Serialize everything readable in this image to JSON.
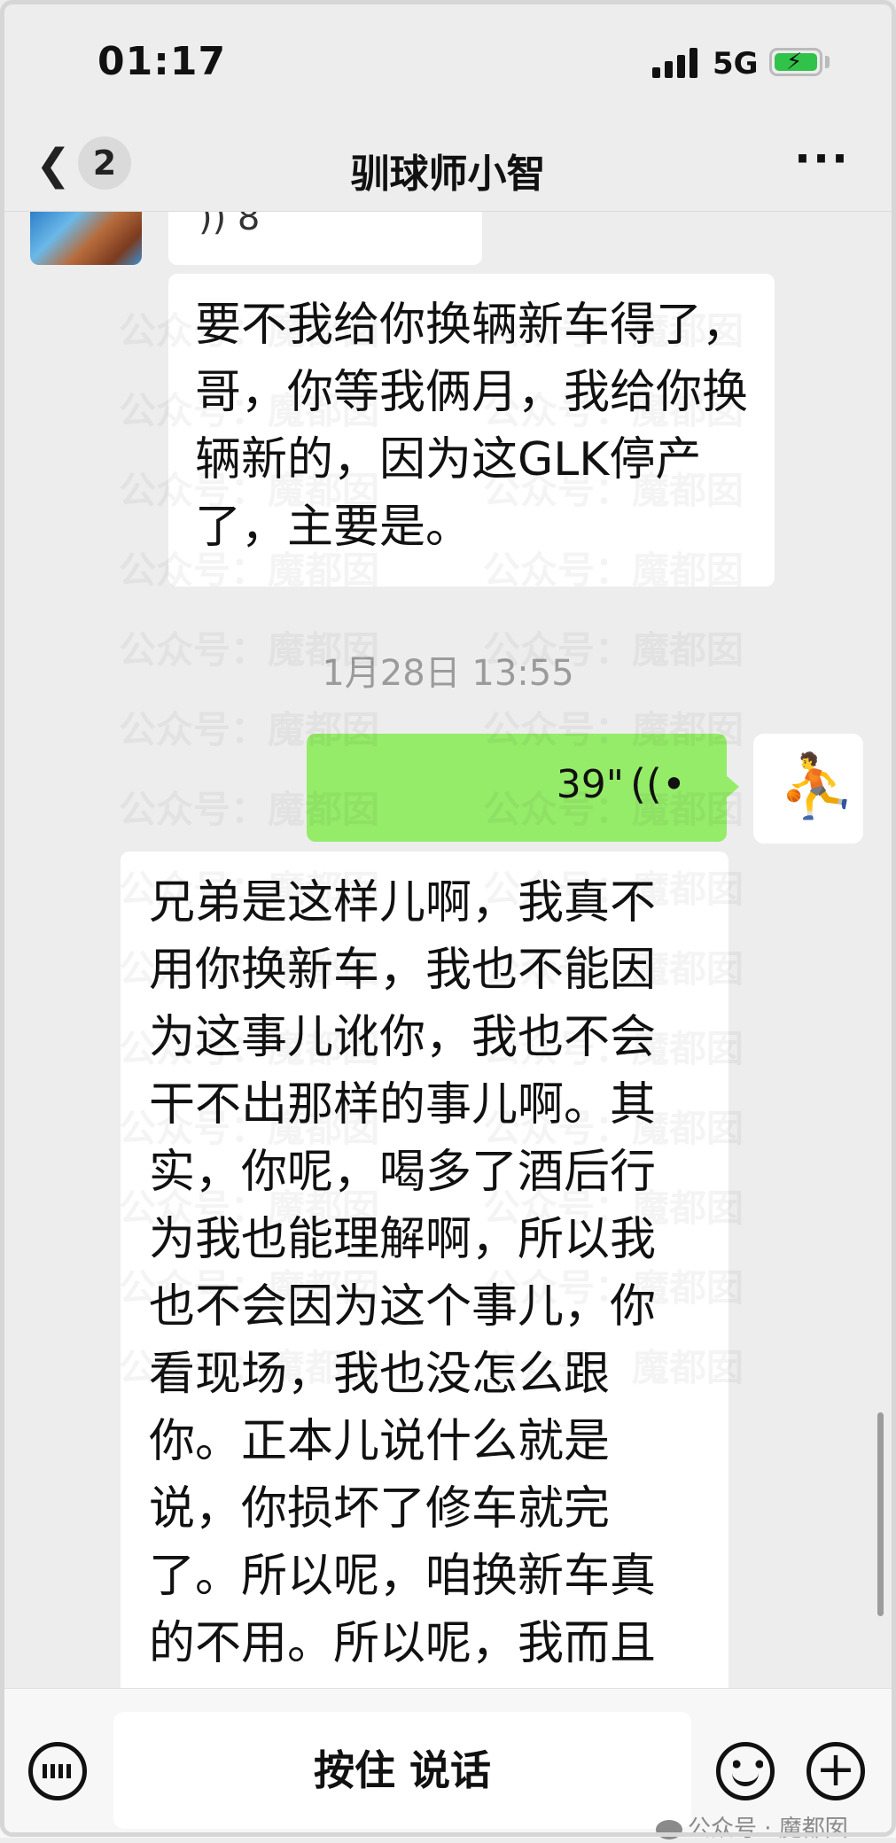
{
  "status_bar": {
    "time": "01:17",
    "network": "5G",
    "battery_charging": true
  },
  "nav": {
    "unread_count": "2",
    "title": "驯球师小智"
  },
  "messages": {
    "msg1": "要不我给你换辆新车得了，哥，你等我俩月，我给你换辆新的，因为这GLK停产了，主要是。",
    "timestamp": "1月28日 13:55",
    "voice_duration": "39\"",
    "msg2": "兄弟是这样儿啊，我真不用你换新车，我也不能因为这事儿讹你，我也不会干不出那样的事儿啊。其实，你呢，喝多了酒后行为我也能理解啊，所以我也不会因为这个事儿，你看现场，我也没怎么跟你。正本儿说什么就是说，你损坏了修车就完了。所以呢，咱换新车真的不用。所以呢，我而且"
  },
  "input_bar": {
    "hold_to_talk": "按住 说话"
  },
  "watermark": {
    "text": "公众号 · 魔都囡"
  },
  "colors": {
    "sent_bubble": "#95ec69",
    "background": "#ededed",
    "bubble": "#ffffff"
  }
}
